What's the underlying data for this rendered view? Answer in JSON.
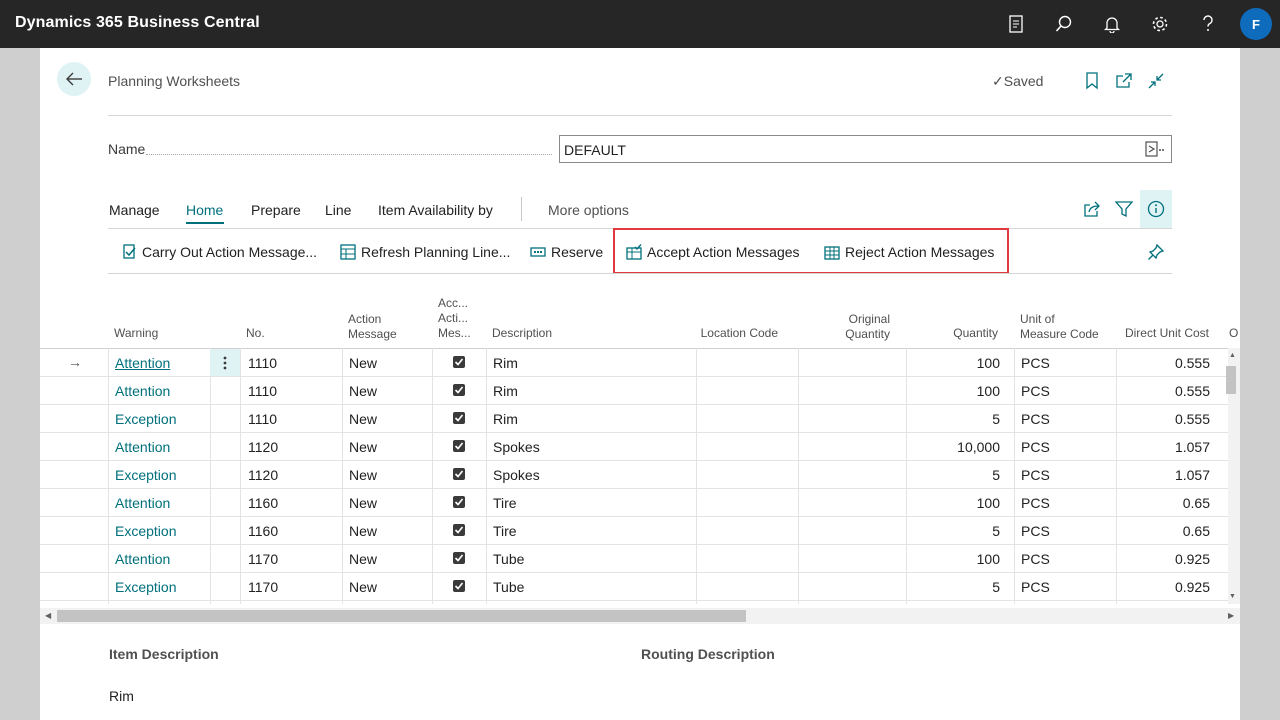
{
  "app": {
    "title": "Dynamics 365 Business Central",
    "user_initial": "F"
  },
  "header": {
    "page_title": "Planning Worksheets",
    "saved_label": "Saved"
  },
  "name_field": {
    "label": "Name",
    "value": "DEFAULT"
  },
  "tabs": [
    {
      "label": "Manage"
    },
    {
      "label": "Home"
    },
    {
      "label": "Prepare"
    },
    {
      "label": "Line"
    },
    {
      "label": "Item Availability by"
    },
    {
      "label": "More options"
    }
  ],
  "actions": [
    {
      "label": "Carry Out Action Message..."
    },
    {
      "label": "Refresh Planning Line..."
    },
    {
      "label": "Reserve"
    },
    {
      "label": "Accept Action Messages"
    },
    {
      "label": "Reject Action Messages"
    }
  ],
  "columns": {
    "warning": "Warning",
    "no": "No.",
    "action_message": [
      "Action",
      "Message"
    ],
    "accept": [
      "Acc...",
      "Acti...",
      "Mes..."
    ],
    "description": "Description",
    "location": "Location Code",
    "original_quantity": [
      "Original",
      "Quantity"
    ],
    "quantity": "Quantity",
    "uom": [
      "Unit of",
      "Measure Code"
    ],
    "direct_unit_cost": "Direct Unit Cost",
    "overflow": "O"
  },
  "rows": [
    {
      "warning": "Attention",
      "no": "1110",
      "action": "New",
      "accept": true,
      "description": "Rim",
      "quantity": "100",
      "uom": "PCS",
      "cost": "0.555"
    },
    {
      "warning": "Attention",
      "no": "1110",
      "action": "New",
      "accept": true,
      "description": "Rim",
      "quantity": "100",
      "uom": "PCS",
      "cost": "0.555"
    },
    {
      "warning": "Exception",
      "no": "1110",
      "action": "New",
      "accept": true,
      "description": "Rim",
      "quantity": "5",
      "uom": "PCS",
      "cost": "0.555"
    },
    {
      "warning": "Attention",
      "no": "1120",
      "action": "New",
      "accept": true,
      "description": "Spokes",
      "quantity": "10,000",
      "uom": "PCS",
      "cost": "1.057"
    },
    {
      "warning": "Exception",
      "no": "1120",
      "action": "New",
      "accept": true,
      "description": "Spokes",
      "quantity": "5",
      "uom": "PCS",
      "cost": "1.057"
    },
    {
      "warning": "Attention",
      "no": "1160",
      "action": "New",
      "accept": true,
      "description": "Tire",
      "quantity": "100",
      "uom": "PCS",
      "cost": "0.65"
    },
    {
      "warning": "Exception",
      "no": "1160",
      "action": "New",
      "accept": true,
      "description": "Tire",
      "quantity": "5",
      "uom": "PCS",
      "cost": "0.65"
    },
    {
      "warning": "Attention",
      "no": "1170",
      "action": "New",
      "accept": true,
      "description": "Tube",
      "quantity": "100",
      "uom": "PCS",
      "cost": "0.925"
    },
    {
      "warning": "Exception",
      "no": "1170",
      "action": "New",
      "accept": true,
      "description": "Tube",
      "quantity": "5",
      "uom": "PCS",
      "cost": "0.925"
    }
  ],
  "factbox": {
    "item_description_label": "Item Description",
    "item_description_value": "Rim",
    "routing_description_label": "Routing Description"
  },
  "colors": {
    "accent": "#00707c",
    "topbar": "#262626",
    "highlight": "#e0393e",
    "avatar": "#0f6cbd"
  }
}
